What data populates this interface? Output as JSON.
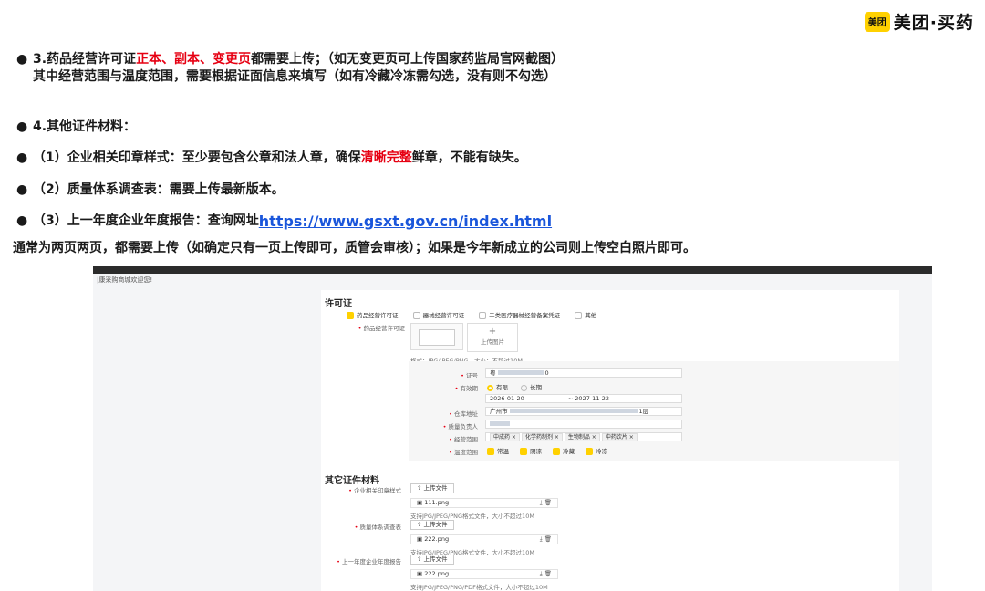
{
  "logo": {
    "mark": "美团",
    "text": "美团·买药"
  },
  "bullets": {
    "line1_a": "3.药品经营许可证",
    "line1_red": "正本、副本、变更页",
    "line1_b": "都需要上传；（如无变更页可上传国家药监局官网截图）",
    "line1_cont": "其中经营范围与温度范围，需要根据证面信息来填写（如有冷藏冷冻需勾选，没有则不勾选）",
    "line2": "4.其他证件材料：",
    "line3_a": "（1）企业相关印章样式：至少要包含公章和法人章，确保",
    "line3_red": "清晰完整",
    "line3_b": "鲜章，不能有缺失。",
    "line4": "（2）质量体系调查表：需要上传最新版本。",
    "line5_a": "（3）上一年度企业年度报告：查询网址",
    "line5_link": "https://www.gsxt.gov.cn/index.html",
    "line6": "通常为两页两页，都需要上传（如确定只有一页上传即可，质管会审核）；如果是今年新成立的公司则上传空白照片即可。"
  },
  "shot": {
    "welcome": "|康采购商城欢迎您!",
    "license_section": "许可证",
    "license_types": [
      "药品经营许可证",
      "器械经营许可证",
      "二类医疗器械经营备案凭证",
      "其他"
    ],
    "license_label": "药品经营许可证",
    "upload_image": "上传图片",
    "format_hint": "格式：JPG/JPEG/PNG，大小：不超过10M",
    "cert_no_label": "证号",
    "cert_no_value": "粤",
    "cert_no_suffix": "0",
    "validity_label": "有效期",
    "validity_options": [
      "有限",
      "长期"
    ],
    "date_start": "2026-01-20",
    "date_end": "2027-11-22",
    "warehouse_label": "仓库地址",
    "warehouse_value": "广州市",
    "warehouse_suffix": "1层",
    "quality_person_label": "质量负责人",
    "scope_label": "经营范围",
    "scope_tags": [
      "中成药 ×",
      "化学药制剂 ×",
      "生物制品 ×",
      "中药饮片 ×"
    ],
    "temp_label": "温度范围",
    "temp_options": [
      "常温",
      "阴凉",
      "冷藏",
      "冷冻"
    ],
    "other_section": "其它证件材料",
    "other_items": [
      {
        "label": "企业相关印章样式",
        "file": "111.png"
      },
      {
        "label": "质量体系调查表",
        "file": "222.png"
      },
      {
        "label": "上一年度企业年度报告",
        "file": "222.png"
      }
    ],
    "upload_file": "上传文件",
    "file_hint": "支持JPG/JPEG/PNG格式文件，大小不超过10M",
    "file_hint_pdf": "支持JPG/JPEG/PNG/PDF格式文件，大小不超过10M",
    "upload_icon": "⇧",
    "download_icon": "⤓",
    "delete_icon": "🗑",
    "file_icon": "▣"
  }
}
